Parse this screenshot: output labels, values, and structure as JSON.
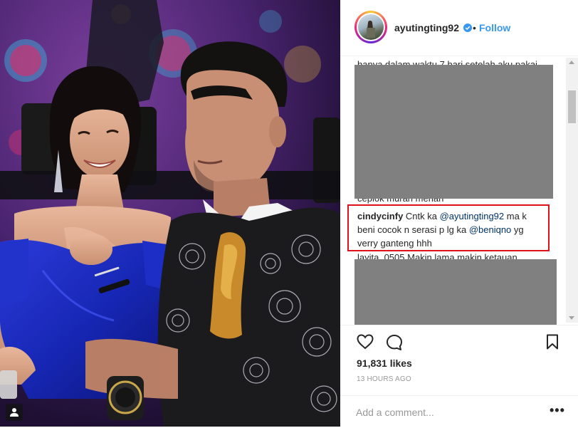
{
  "post": {
    "username": "ayutingting92",
    "separator": "•",
    "follow_label": "Follow",
    "likes": "91,831 likes",
    "timestamp": "13 HOURS AGO",
    "comment_placeholder": "Add a comment...",
    "more_label": "•••"
  },
  "comments": {
    "partial_top": "hanya dalam waktu 7 hari setelah aku pakai",
    "partial_mid": "ceplok murah meriah",
    "partial_bottom": "layita_0505 Makin lama makin ketauan",
    "highlighted": {
      "user": "cindycinfy",
      "text1": " Cntk ka ",
      "mention1": "@ayutingting92",
      "text2": " ma k",
      "line2": "beni cocok n serasi p lg ka ",
      "mention2": "@beniqno",
      "text3": " yg",
      "line3": "verry ganteng hhh"
    }
  },
  "colors": {
    "accent": "#3897f0",
    "highlight_border": "#e0111b",
    "redaction": "#808080"
  },
  "icons": [
    "verified-badge-icon",
    "heart-icon",
    "comment-icon",
    "bookmark-icon",
    "user-tag-icon",
    "more-options-icon"
  ]
}
